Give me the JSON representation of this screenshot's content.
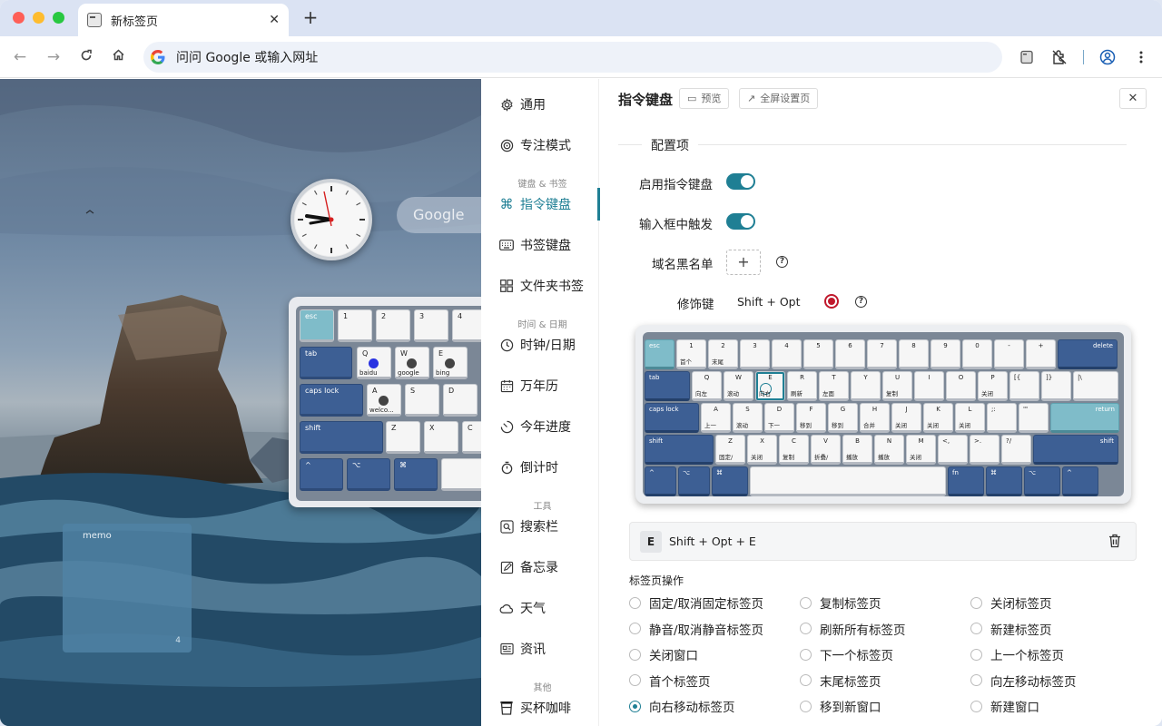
{
  "browser": {
    "tab_title": "新标签页",
    "omnibox_placeholder": "问问 Google 或输入网址"
  },
  "newtab": {
    "search_label": "Google",
    "memo_title": "memo",
    "memo_count": "4",
    "bg_keys": {
      "r1": [
        "esc",
        "1",
        "2",
        "3",
        "4"
      ],
      "r2": [
        "tab",
        "Q",
        "W",
        "E"
      ],
      "r2_actions": [
        "baidu",
        "google",
        "bing"
      ],
      "r3": [
        "caps lock",
        "A",
        "S",
        "D"
      ],
      "r3_actions": [
        "welco..."
      ],
      "r4": [
        "shift",
        "Z",
        "X",
        "C"
      ],
      "r5": [
        "^",
        "⌥",
        "⌘"
      ]
    }
  },
  "sidebar": {
    "items": [
      {
        "label": "通用",
        "icon": "gear-icon"
      },
      {
        "label": "专注模式",
        "icon": "target-icon"
      },
      {
        "label": "指令键盘",
        "icon": "command-icon"
      },
      {
        "label": "书签键盘",
        "icon": "keyboard-icon"
      },
      {
        "label": "文件夹书签",
        "icon": "grid-icon"
      },
      {
        "label": "时钟/日期",
        "icon": "clock-icon"
      },
      {
        "label": "万年历",
        "icon": "calendar-icon"
      },
      {
        "label": "今年进度",
        "icon": "progress-icon"
      },
      {
        "label": "倒计时",
        "icon": "timer-icon"
      },
      {
        "label": "搜索栏",
        "icon": "search-icon"
      },
      {
        "label": "备忘录",
        "icon": "memo-icon"
      },
      {
        "label": "天气",
        "icon": "cloud-icon"
      },
      {
        "label": "资讯",
        "icon": "news-icon"
      },
      {
        "label": "买杯咖啡",
        "icon": "coffee-icon"
      }
    ],
    "groups": [
      "键盘 & 书签",
      "时间 & 日期",
      "工具",
      "其他"
    ]
  },
  "panel": {
    "title": "指令键盘",
    "preview_label": "预览",
    "fullscreen_label": "全屏设置页",
    "section_label": "配置项",
    "enable_label": "启用指令键盘",
    "enable_on": true,
    "input_trigger_label": "输入框中触发",
    "input_trigger_on": true,
    "blacklist_label": "域名黑名单",
    "modifier_label": "修饰键",
    "modifier_value": "Shift + Opt",
    "binding_key": "E",
    "binding_text": "Shift + Opt + E",
    "group_title": "标签页操作",
    "options": [
      "固定/取消固定标签页",
      "复制标签页",
      "关闭标签页",
      "静音/取消静音标签页",
      "刷新所有标签页",
      "新建标签页",
      "关闭窗口",
      "下一个标签页",
      "上一个标签页",
      "首个标签页",
      "末尾标签页",
      "向左移动标签页",
      "向右移动标签页",
      "移到新窗口",
      "新建窗口"
    ],
    "selected_option": "向右移动标签页"
  },
  "keyboard": {
    "row1": [
      "esc",
      "1",
      "2",
      "3",
      "4",
      "5",
      "6",
      "7",
      "8",
      "9",
      "0",
      "-",
      "+",
      "delete"
    ],
    "row1_actions": [
      "",
      "首个",
      "末尾",
      "",
      "",
      "",
      "",
      "",
      "",
      "",
      "",
      "",
      "",
      ""
    ],
    "row2": [
      "tab",
      "Q",
      "W",
      "E",
      "R",
      "T",
      "Y",
      "U",
      "I",
      "O",
      "P",
      "[{",
      "]}",
      "|\\"
    ],
    "row2_actions": [
      "",
      "向左",
      "滚动",
      "向右",
      "刷新",
      "左面",
      "",
      "复制",
      "",
      "",
      "关闭",
      "",
      "",
      ""
    ],
    "row3": [
      "caps lock",
      "A",
      "S",
      "D",
      "F",
      "G",
      "H",
      "J",
      "K",
      "L",
      ";:",
      "'\"",
      "return"
    ],
    "row3_actions": [
      "",
      "上一",
      "滚动",
      "下一",
      "移到",
      "移到",
      "合并",
      "关闭",
      "关闭",
      "关闭",
      "",
      "",
      ""
    ],
    "row4": [
      "shift",
      "Z",
      "X",
      "C",
      "V",
      "B",
      "N",
      "M",
      "<,",
      ">.",
      "?/",
      "shift"
    ],
    "row4_actions": [
      "",
      "固定/",
      "关闭",
      "复制",
      "折叠/",
      "播放",
      "播放",
      "关闭",
      "",
      "",
      "",
      ""
    ],
    "row5": [
      "^",
      "⌥",
      "⌘",
      "",
      "fn",
      "⌘",
      "⌥",
      "^"
    ],
    "selected_key": "E"
  }
}
